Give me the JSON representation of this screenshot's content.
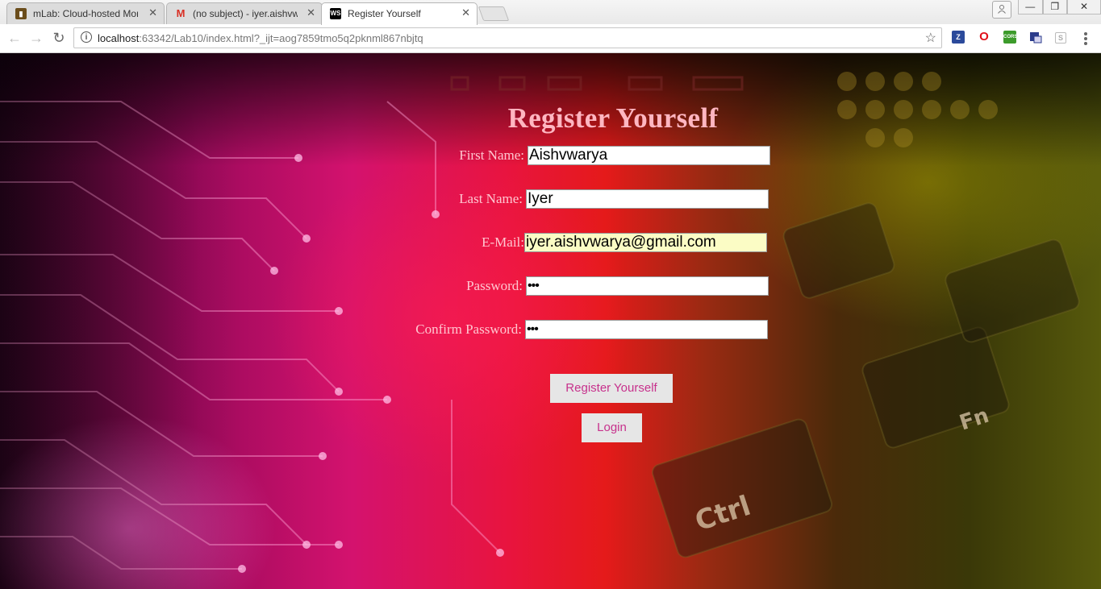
{
  "browser": {
    "tabs": [
      {
        "title": "mLab: Cloud-hosted Mon",
        "favicon": "mlab-leaf-icon",
        "active": false
      },
      {
        "title": "(no subject) - iyer.aishvw",
        "favicon": "gmail-icon",
        "active": false
      },
      {
        "title": "Register Yourself",
        "favicon": "ws-icon",
        "active": true
      }
    ],
    "favicon_labels": {
      "gmail": "M",
      "webstorm": "WS"
    },
    "tab_close": "✕",
    "url_host": "localhost",
    "url_rest": ":63342/Lab10/index.html?_ijt=aog7859tmo5q2pknml867nbjtq",
    "extensions": [
      {
        "name": "zotero-icon",
        "label": "Z",
        "color": "#2b4a9b"
      },
      {
        "name": "opera-icon",
        "label": "O",
        "color": "#e0101a"
      },
      {
        "name": "cors-icon",
        "label": "CORS",
        "color": "#3c9b2b"
      },
      {
        "name": "translate-icon",
        "label": "",
        "color": "#2b3b8b"
      },
      {
        "name": "extension-icon",
        "label": "S",
        "color": "#aaaaaa"
      }
    ]
  },
  "page": {
    "title": "Register Yourself",
    "form": {
      "first_name_label": "First Name:",
      "first_name_value": "Aishvwarya",
      "last_name_label": "Last Name:",
      "last_name_value": "Iyer",
      "email_label": "E-Mail:",
      "email_value": "iyer.aishvwarya@gmail.com",
      "password_label": "Password:",
      "password_value": "•••",
      "confirm_password_label": "Confirm Password:",
      "confirm_password_value": "•••",
      "register_button": "Register Yourself",
      "login_button": "Login"
    },
    "colors": {
      "title": "#ffb6c1",
      "label": "#ffc6d0",
      "button_text": "#c7318c",
      "autofill_bg": "#fbfcc5"
    }
  }
}
